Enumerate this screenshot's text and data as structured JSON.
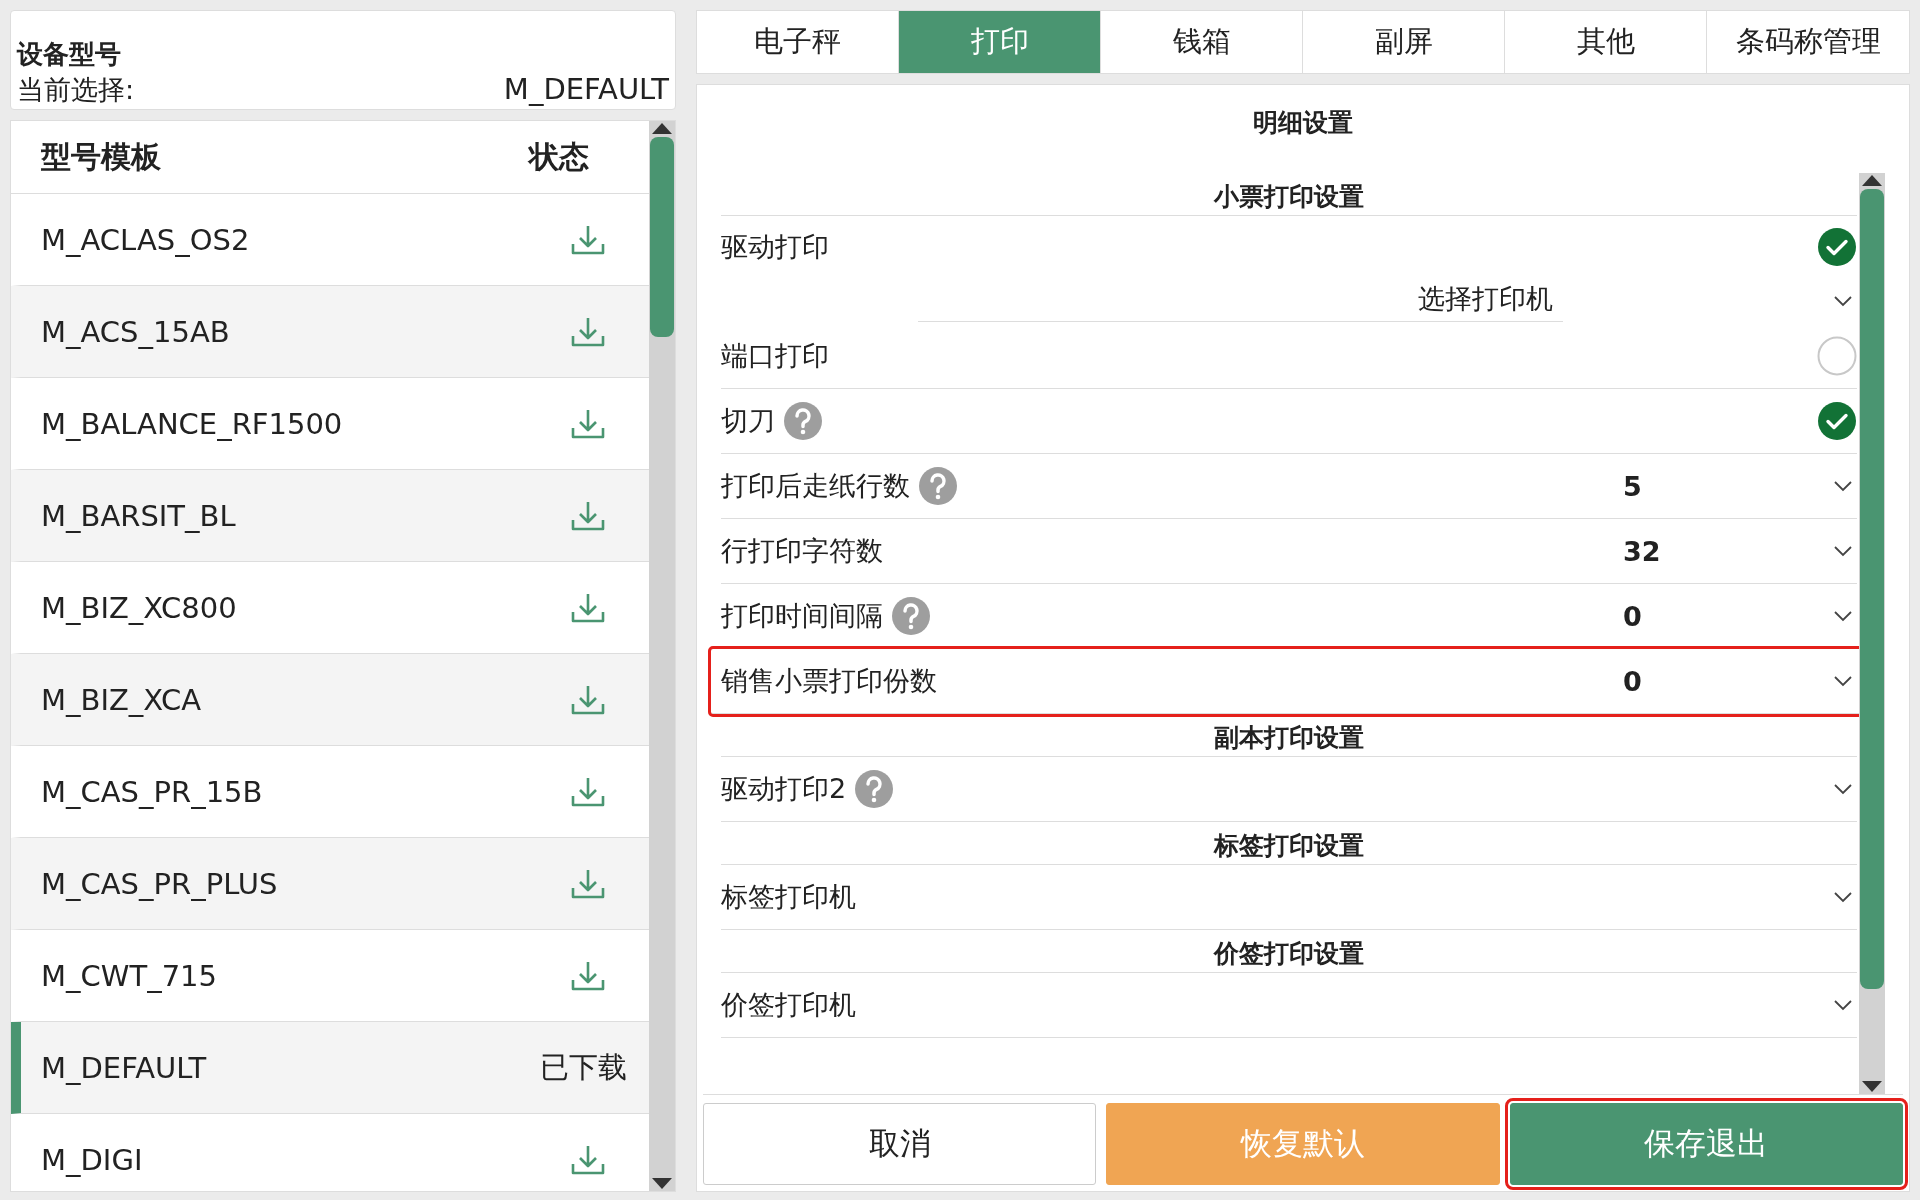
{
  "device": {
    "title": "设备型号",
    "current_label": "当前选择:",
    "current_value": "M_DEFAULT"
  },
  "model_list": {
    "columns": [
      "型号模板",
      "状态"
    ],
    "rows": [
      {
        "name": "M_ACLAS_OS2",
        "selected": false,
        "downloaded": false
      },
      {
        "name": "M_ACS_15AB",
        "selected": false,
        "downloaded": false
      },
      {
        "name": "M_BALANCE_RF1500",
        "selected": false,
        "downloaded": false
      },
      {
        "name": "M_BARSIT_BL",
        "selected": false,
        "downloaded": false
      },
      {
        "name": "M_BIZ_XC800",
        "selected": false,
        "downloaded": false
      },
      {
        "name": "M_BIZ_XCA",
        "selected": false,
        "downloaded": false
      },
      {
        "name": "M_CAS_PR_15B",
        "selected": false,
        "downloaded": false
      },
      {
        "name": "M_CAS_PR_PLUS",
        "selected": false,
        "downloaded": false
      },
      {
        "name": "M_CWT_715",
        "selected": false,
        "downloaded": false
      },
      {
        "name": "M_DEFAULT",
        "selected": true,
        "downloaded": true,
        "status": "已下载"
      },
      {
        "name": "M_DIGI",
        "selected": false,
        "downloaded": false
      }
    ]
  },
  "tabs": [
    {
      "label": "电子秤",
      "selected": false
    },
    {
      "label": "打印",
      "selected": true
    },
    {
      "label": "钱箱",
      "selected": false
    },
    {
      "label": "副屏",
      "selected": false
    },
    {
      "label": "其他",
      "selected": false
    },
    {
      "label": "条码称管理",
      "selected": false
    }
  ],
  "settings": {
    "title": "明细设置",
    "sections": [
      {
        "title": "小票打印设置",
        "rows": [
          {
            "kind": "toggle",
            "label": "驱动打印",
            "on": true,
            "picker": "选择打印机"
          },
          {
            "kind": "toggle",
            "label": "端口打印",
            "on": false
          },
          {
            "kind": "toggle",
            "label": "切刀",
            "help": true,
            "on": true
          },
          {
            "kind": "select",
            "label": "打印后走纸行数",
            "help": true,
            "value": "5"
          },
          {
            "kind": "select",
            "label": "行打印字符数",
            "value": "32"
          },
          {
            "kind": "select",
            "label": "打印时间间隔",
            "help": true,
            "value": "0"
          },
          {
            "kind": "select",
            "label": "销售小票打印份数",
            "value": "0",
            "highlighted": true
          }
        ]
      },
      {
        "title": "副本打印设置",
        "rows": [
          {
            "kind": "select",
            "label": "驱动打印2",
            "help": true
          }
        ]
      },
      {
        "title": "标签打印设置",
        "rows": [
          {
            "kind": "select",
            "label": "标签打印机"
          }
        ]
      },
      {
        "title": "价签打印设置",
        "rows": [
          {
            "kind": "select",
            "label": "价签打印机"
          }
        ]
      }
    ]
  },
  "buttons": [
    {
      "label": "取消",
      "kind": "plain",
      "highlighted": false
    },
    {
      "label": "恢复默认",
      "kind": "warning",
      "highlighted": false
    },
    {
      "label": "保存退出",
      "kind": "primary",
      "highlighted": true
    }
  ]
}
